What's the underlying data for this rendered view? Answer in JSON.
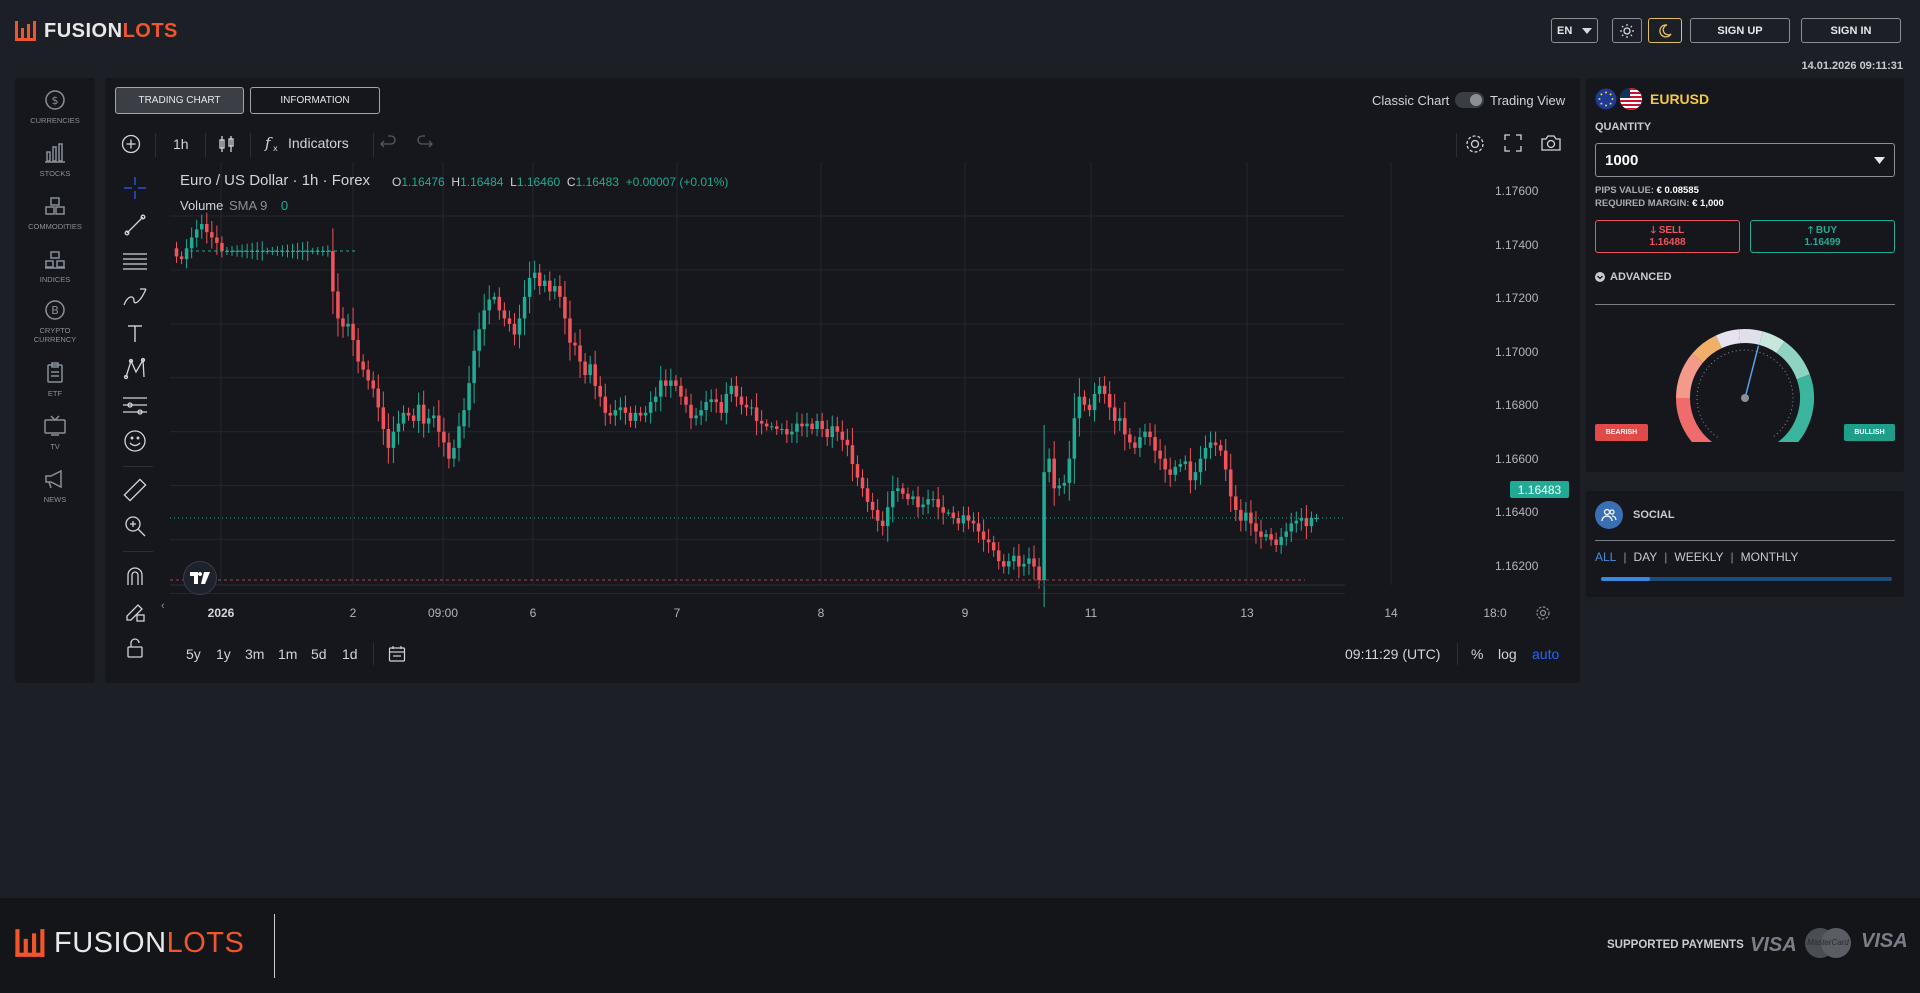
{
  "header": {
    "logo_a": "FUSION",
    "logo_b": "LOTS",
    "language": "EN",
    "sign_up": "SIGN UP",
    "sign_in": "SIGN IN",
    "datetime": "14.01.2026 09:11:31"
  },
  "categories": [
    {
      "label": "CURRENCIES",
      "icon": "dollar-coin-icon"
    },
    {
      "label": "STOCKS",
      "icon": "bar-chart-icon"
    },
    {
      "label": "COMMODITIES",
      "icon": "boxes-icon"
    },
    {
      "label": "INDICES",
      "icon": "stack-icon"
    },
    {
      "label": "CRYPTO CURRENCY",
      "icon": "bitcoin-icon"
    },
    {
      "label": "ETF",
      "icon": "clipboard-icon"
    },
    {
      "label": "TV",
      "icon": "tv-icon"
    },
    {
      "label": "NEWS",
      "icon": "megaphone-icon"
    }
  ],
  "chart_panel": {
    "tab_chart": "TRADING CHART",
    "tab_info": "INFORMATION",
    "toggle_left": "Classic Chart",
    "toggle_right": "Trading View",
    "interval": "1h",
    "indicators": "Indicators",
    "legend": {
      "title": "Euro / US Dollar · 1h · Forex",
      "o_label": "O",
      "o": "1.16476",
      "h_label": "H",
      "h": "1.16484",
      "l_label": "L",
      "l": "1.16460",
      "c_label": "C",
      "c": "1.16483",
      "change": "+0.00007 (+0.01%)",
      "volume": "Volume",
      "sma": "SMA 9",
      "sma_value": "0"
    },
    "y_labels": [
      "1.17600",
      "1.17400",
      "1.17200",
      "1.17000",
      "1.16800",
      "1.16600",
      "1.16400",
      "1.16200"
    ],
    "current_price": "1.16483",
    "x_labels": [
      {
        "t": "2026",
        "bold": true
      },
      {
        "t": "2"
      },
      {
        "t": "09:00"
      },
      {
        "t": "6"
      },
      {
        "t": "7"
      },
      {
        "t": "8"
      },
      {
        "t": "9"
      },
      {
        "t": "11"
      },
      {
        "t": "13"
      },
      {
        "t": "14"
      },
      {
        "t": "18:0"
      }
    ],
    "ranges": [
      "5y",
      "1y",
      "3m",
      "1m",
      "5d",
      "1d"
    ],
    "clock": "09:11:29 (UTC)",
    "pct": "%",
    "log": "log",
    "auto": "auto"
  },
  "chart_data": {
    "type": "candlestick",
    "title": "Euro / US Dollar · 1h · Forex",
    "ylim": [
      1.1615,
      1.178
    ],
    "close": [
      1.1745,
      1.1744,
      1.1748,
      1.1752,
      1.1755,
      1.1757,
      1.1754,
      1.1752,
      1.175,
      1.1747,
      1.1747,
      1.1747,
      1.1747,
      1.1747,
      1.1747,
      1.1747,
      1.1747,
      1.1747,
      1.1747,
      1.1747,
      1.1747,
      1.1747,
      1.1747,
      1.1747,
      1.1747,
      1.1747,
      1.1747,
      1.1747,
      1.1747,
      1.1747,
      1.1747,
      1.1732,
      1.1722,
      1.1719,
      1.172,
      1.1714,
      1.1706,
      1.1703,
      1.1699,
      1.1696,
      1.1689,
      1.1681,
      1.1674,
      1.168,
      1.1683,
      1.1687,
      1.1686,
      1.1684,
      1.169,
      1.1683,
      1.1685,
      1.1686,
      1.168,
      1.1676,
      1.167,
      1.1674,
      1.1682,
      1.1688,
      1.1698,
      1.171,
      1.1718,
      1.1725,
      1.1729,
      1.173,
      1.1725,
      1.1722,
      1.172,
      1.1716,
      1.1722,
      1.173,
      1.1737,
      1.1739,
      1.1734,
      1.1736,
      1.1732,
      1.1734,
      1.173,
      1.1722,
      1.1713,
      1.1712,
      1.1706,
      1.1701,
      1.1705,
      1.1697,
      1.1693,
      1.1687,
      1.1686,
      1.1688,
      1.1689,
      1.1687,
      1.1684,
      1.1687,
      1.1686,
      1.1687,
      1.1691,
      1.1693,
      1.1699,
      1.1697,
      1.1699,
      1.1697,
      1.1693,
      1.169,
      1.1685,
      1.1686,
      1.1688,
      1.1691,
      1.1692,
      1.1691,
      1.1687,
      1.1694,
      1.1697,
      1.1693,
      1.169,
      1.1689,
      1.1689,
      1.1684,
      1.1683,
      1.1682,
      1.1682,
      1.1681,
      1.1681,
      1.1679,
      1.168,
      1.1683,
      1.1682,
      1.1683,
      1.1681,
      1.1684,
      1.1681,
      1.1678,
      1.1682,
      1.168,
      1.1677,
      1.1675,
      1.1668,
      1.1663,
      1.1659,
      1.1654,
      1.1651,
      1.1647,
      1.1645,
      1.1652,
      1.1658,
      1.1659,
      1.1657,
      1.1655,
      1.1656,
      1.1652,
      1.1653,
      1.1655,
      1.1655,
      1.1652,
      1.165,
      1.165,
      1.1648,
      1.1646,
      1.1649,
      1.1647,
      1.1646,
      1.1643,
      1.164,
      1.1639,
      1.1636,
      1.1632,
      1.163,
      1.1632,
      1.1634,
      1.163,
      1.1631,
      1.1633,
      1.163,
      1.1625,
      1.1665,
      1.167,
      1.1659,
      1.166,
      1.1661,
      1.167,
      1.1685,
      1.1693,
      1.169,
      1.1688,
      1.1694,
      1.1697,
      1.1694,
      1.1689,
      1.1684,
      1.1685,
      1.1679,
      1.1676,
      1.1674,
      1.1678,
      1.168,
      1.1678,
      1.1673,
      1.167,
      1.1666,
      1.1664,
      1.1667,
      1.1668,
      1.1669,
      1.1662,
      1.1665,
      1.167,
      1.1674,
      1.1676,
      1.1675,
      1.1673,
      1.1666,
      1.1656,
      1.1651,
      1.1647,
      1.165,
      1.1646,
      1.1643,
      1.1641,
      1.1642,
      1.164,
      1.1638,
      1.1641,
      1.1643,
      1.1646,
      1.1647,
      1.1648,
      1.1645,
      1.1648,
      1.1648
    ]
  },
  "trade": {
    "symbol": "EURUSD",
    "quantity_label": "QUANTITY",
    "quantity": "1000",
    "pips_label": "PIPS VALUE:",
    "pips_value": "€ 0.08585",
    "margin_label": "REQUIRED MARGIN:",
    "margin_value": "€ 1,000",
    "sell_label": "SELL",
    "sell_price": "1.16488",
    "buy_label": "BUY",
    "buy_price": "1.16499",
    "advanced": "ADVANCED",
    "bearish": "BEARISH",
    "bullish": "BULLISH",
    "sentiment": 0.55
  },
  "social": {
    "title": "SOCIAL",
    "filters": [
      "ALL",
      "DAY",
      "WEEKLY",
      "MONTHLY"
    ],
    "progress": 0.17
  },
  "footer": {
    "logo_a": "FUSION",
    "logo_b": "LOTS",
    "payments": "SUPPORTED PAYMENTS",
    "pay1": "VISA",
    "pay2": "MasterCard",
    "pay3": "VISA"
  },
  "colors": {
    "accent": "#f0562a",
    "up": "#22ab94",
    "down": "#f0535b",
    "blue": "#2962ff"
  }
}
